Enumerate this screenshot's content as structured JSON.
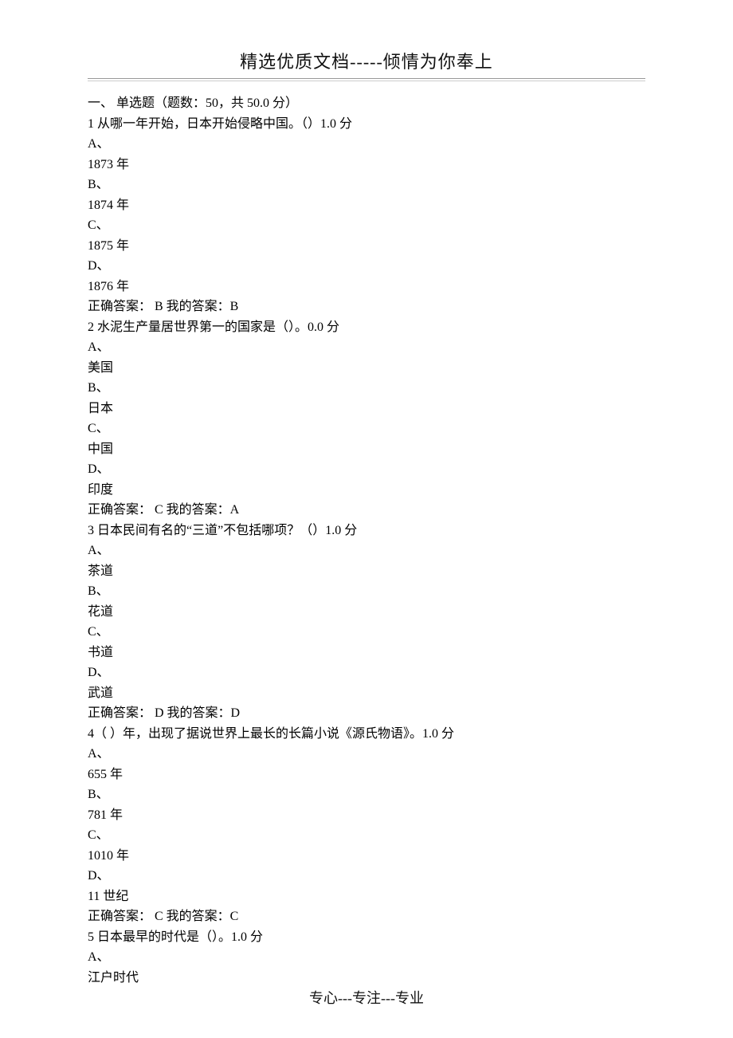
{
  "header": {
    "title": "精选优质文档-----倾情为你奉上"
  },
  "footer": {
    "text": "专心---专注---专业"
  },
  "section_heading": "一、 单选题（题数：50，共 50.0 分）",
  "questions": [
    {
      "num": "1",
      "text": "从哪一年开始，日本开始侵略中国。（）1.0 分",
      "options": [
        {
          "label": "A、",
          "value": "1873 年"
        },
        {
          "label": "B、",
          "value": "1874 年"
        },
        {
          "label": "C、",
          "value": "1875 年"
        },
        {
          "label": "D、",
          "value": "1876 年"
        }
      ],
      "correct": "正确答案： B  我的答案：B"
    },
    {
      "num": "2",
      "text": "水泥生产量居世界第一的国家是（）。0.0 分",
      "options": [
        {
          "label": "A、",
          "value": "美国"
        },
        {
          "label": "B、",
          "value": "日本"
        },
        {
          "label": "C、",
          "value": "中国"
        },
        {
          "label": "D、",
          "value": "印度"
        }
      ],
      "correct": "正确答案： C  我的答案：A"
    },
    {
      "num": "3",
      "text": "日本民间有名的“三道”不包括哪项？（）1.0 分",
      "options": [
        {
          "label": "A、",
          "value": "茶道"
        },
        {
          "label": "B、",
          "value": "花道"
        },
        {
          "label": "C、",
          "value": "书道"
        },
        {
          "label": "D、",
          "value": "武道"
        }
      ],
      "correct": "正确答案： D  我的答案：D"
    },
    {
      "num": "4",
      "text": "（ ）年，出现了据说世界上最长的长篇小说《源氏物语》。1.0 分",
      "options": [
        {
          "label": "A、",
          "value": "655 年"
        },
        {
          "label": "B、",
          "value": "781 年"
        },
        {
          "label": "C、",
          "value": "1010 年"
        },
        {
          "label": "D、",
          "value": "11 世纪"
        }
      ],
      "correct": "正确答案： C  我的答案：C"
    },
    {
      "num": "5",
      "text": "日本最早的时代是（）。1.0 分",
      "options_partial": [
        {
          "label": "A、",
          "value": "江户时代"
        }
      ]
    }
  ]
}
